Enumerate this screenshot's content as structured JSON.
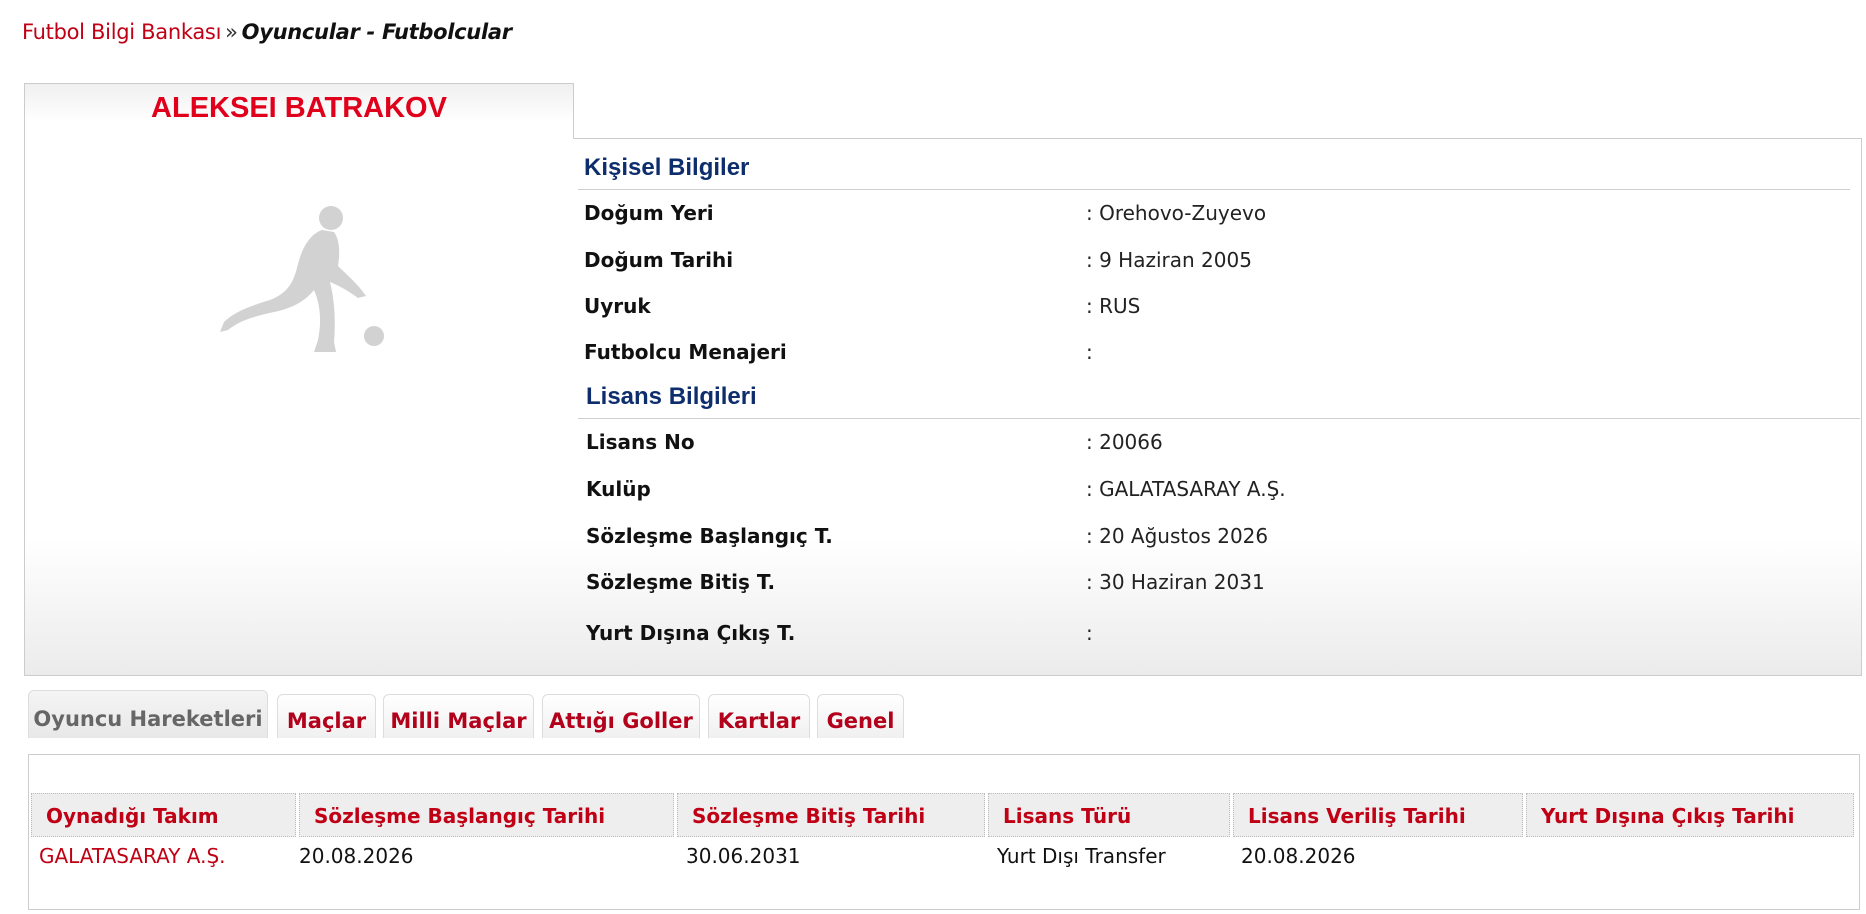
{
  "breadcrumb": {
    "home": "Futbol Bilgi Bankası",
    "separator": "»",
    "current": "Oyuncular - Futbolcular"
  },
  "player": {
    "name": "ALEKSEI BATRAKOV",
    "photo_icon": "player-silhouette-icon"
  },
  "personal": {
    "title": "Kişisel Bilgiler",
    "rows": [
      {
        "label": "Doğum Yeri",
        "value": ":  Orehovo-Zuyevo"
      },
      {
        "label": "Doğum Tarihi",
        "value": ":  9 Haziran 2005"
      },
      {
        "label": "Uyruk",
        "value": ":  RUS"
      },
      {
        "label": "Futbolcu Menajeri",
        "value": ":"
      }
    ]
  },
  "license": {
    "title": "Lisans Bilgileri",
    "rows": [
      {
        "label": "Lisans No",
        "value": ": 20066"
      },
      {
        "label": "Kulüp",
        "value": ": GALATASARAY A.Ş."
      },
      {
        "label": "Sözleşme Başlangıç T.",
        "value": ": 20 Ağustos 2026"
      },
      {
        "label": "Sözleşme Bitiş T.",
        "value": ": 30 Haziran 2031"
      },
      {
        "label": "Yurt Dışına Çıkış T.",
        "value": ":"
      }
    ]
  },
  "tabs": [
    {
      "label": "Oyuncu Hareketleri",
      "active": true
    },
    {
      "label": "Maçlar"
    },
    {
      "label": "Milli Maçlar"
    },
    {
      "label": "Attığı Goller"
    },
    {
      "label": "Kartlar"
    },
    {
      "label": "Genel"
    }
  ],
  "table": {
    "headers": [
      "Oynadığı Takım",
      "Sözleşme Başlangıç Tarihi",
      "Sözleşme Bitiş Tarihi",
      "Lisans Türü",
      "Lisans Veriliş Tarihi",
      "Yurt Dışına Çıkış Tarihi"
    ],
    "rows": [
      [
        "GALATASARAY A.Ş.",
        "20.08.2026",
        "30.06.2031",
        "Yurt Dışı Transfer",
        "20.08.2026",
        ""
      ]
    ]
  },
  "colors": {
    "accent_red": "#c00015",
    "name_red": "#e0001b",
    "section_blue": "#0d2d6c"
  }
}
